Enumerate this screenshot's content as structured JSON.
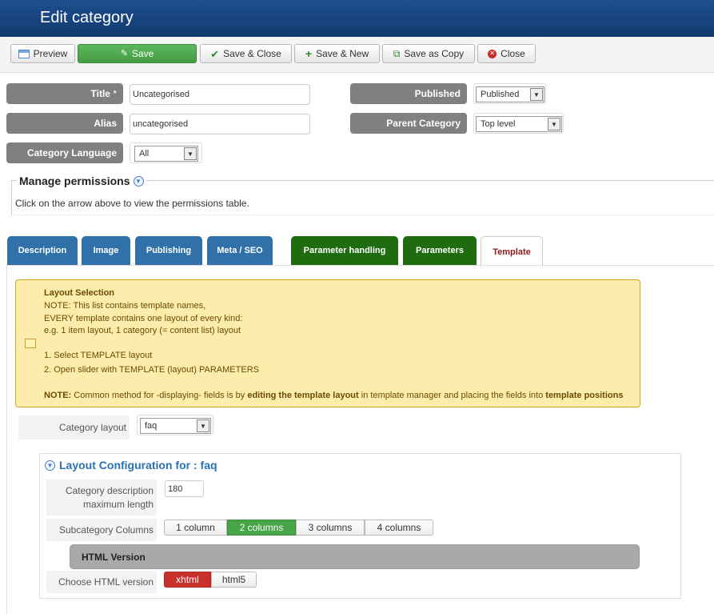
{
  "header": {
    "title": "Edit category"
  },
  "toolbar": {
    "preview": "Preview",
    "save": "Save",
    "save_close": "Save & Close",
    "save_new": "Save & New",
    "save_copy": "Save as Copy",
    "close": "Close"
  },
  "form": {
    "title_label": "Title",
    "title_req": "*",
    "title_value": "Uncategorised",
    "alias_label": "Alias",
    "alias_value": "uncategorised",
    "language_label": "Category Language",
    "language_value": "All",
    "published_label": "Published",
    "published_value": "Published",
    "parent_label": "Parent Category",
    "parent_value": "Top level"
  },
  "permissions": {
    "legend": "Manage permissions",
    "note": "Click on the arrow above to view the permissions table."
  },
  "tabs": [
    {
      "label": "Description"
    },
    {
      "label": "Image"
    },
    {
      "label": "Publishing"
    },
    {
      "label": "Meta / SEO"
    },
    {
      "label": "Parameter handling"
    },
    {
      "label": "Parameters"
    },
    {
      "label": "Template"
    }
  ],
  "notice": {
    "title": "Layout Selection",
    "line1": "NOTE: This list contains template names,",
    "line2": "EVERY template contains one layout of every kind:",
    "line3": "e.g. 1 item layout, 1 category (= content list) layout",
    "step1": "1.  Select TEMPLATE layout",
    "step2": "2.  Open slider with TEMPLATE (layout) PARAMETERS",
    "final_note": "NOTE:",
    "final_a": " Common method for -displaying- fields is by ",
    "final_b": "editing the template layout",
    "final_c": " in template manager and placing the fields into ",
    "final_d": "template positions"
  },
  "category_layout": {
    "label": "Category layout",
    "value": "faq"
  },
  "config": {
    "heading": "Layout Configuration for : faq",
    "desc_label_1": "Category description",
    "desc_label_2": "maximum length",
    "desc_value": "180",
    "subcat_label": "Subcategory Columns",
    "columns": [
      "1 column",
      "2 columns",
      "3 columns",
      "4 columns"
    ],
    "selected_column": "2 columns",
    "html_version_heading": "HTML Version",
    "html_label": "Choose HTML version",
    "html_options": [
      "xhtml",
      "html5"
    ],
    "html_selected": "xhtml"
  },
  "colors": {
    "save": "#4cae4c",
    "tab_blue": "#3071a9",
    "tab_green": "#1e6b10",
    "active_tab_text": "#8b1a1a",
    "notice_bg": "#fcedac"
  }
}
